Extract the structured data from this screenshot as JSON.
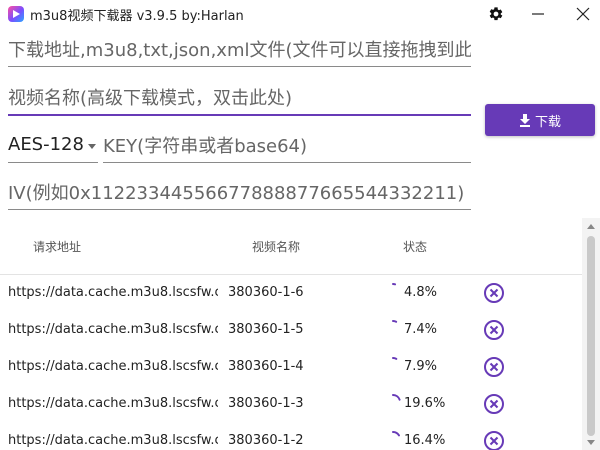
{
  "window": {
    "title": "m3u8视频下载器 v3.9.5 by:Harlan"
  },
  "form": {
    "url_placeholder": "下载地址,m3u8,txt,json,xml文件(文件可以直接拖拽到此",
    "name_placeholder": "视频名称(高级下载模式，双击此处)",
    "encryption_value": "AES-128",
    "key_placeholder": "KEY(字符串或者base64)",
    "iv_placeholder": "IV(例如0x11223344556677888877665544332211)",
    "download_label": "下载"
  },
  "table": {
    "headers": {
      "url": "请求地址",
      "name": "视频名称",
      "status": "状态"
    },
    "rows": [
      {
        "url": "https://data.cache.m3u8.lscsfw.co",
        "name": "380360-1-6",
        "status": "4.8%",
        "progress": 0.048
      },
      {
        "url": "https://data.cache.m3u8.lscsfw.co",
        "name": "380360-1-5",
        "status": "7.4%",
        "progress": 0.074
      },
      {
        "url": "https://data.cache.m3u8.lscsfw.co",
        "name": "380360-1-4",
        "status": "7.9%",
        "progress": 0.079
      },
      {
        "url": "https://data.cache.m3u8.lscsfw.co",
        "name": "380360-1-3",
        "status": "19.6%",
        "progress": 0.196
      },
      {
        "url": "https://data.cache.m3u8.lscsfw.co",
        "name": "380360-1-2",
        "status": "16.4%",
        "progress": 0.164
      }
    ]
  },
  "colors": {
    "accent": "#673ab7",
    "progress": "#673ab7"
  },
  "icons": {
    "settings": "gear-icon",
    "minimize": "minimize-icon",
    "close": "close-icon",
    "download": "download-icon",
    "remove": "remove-circle-icon"
  }
}
